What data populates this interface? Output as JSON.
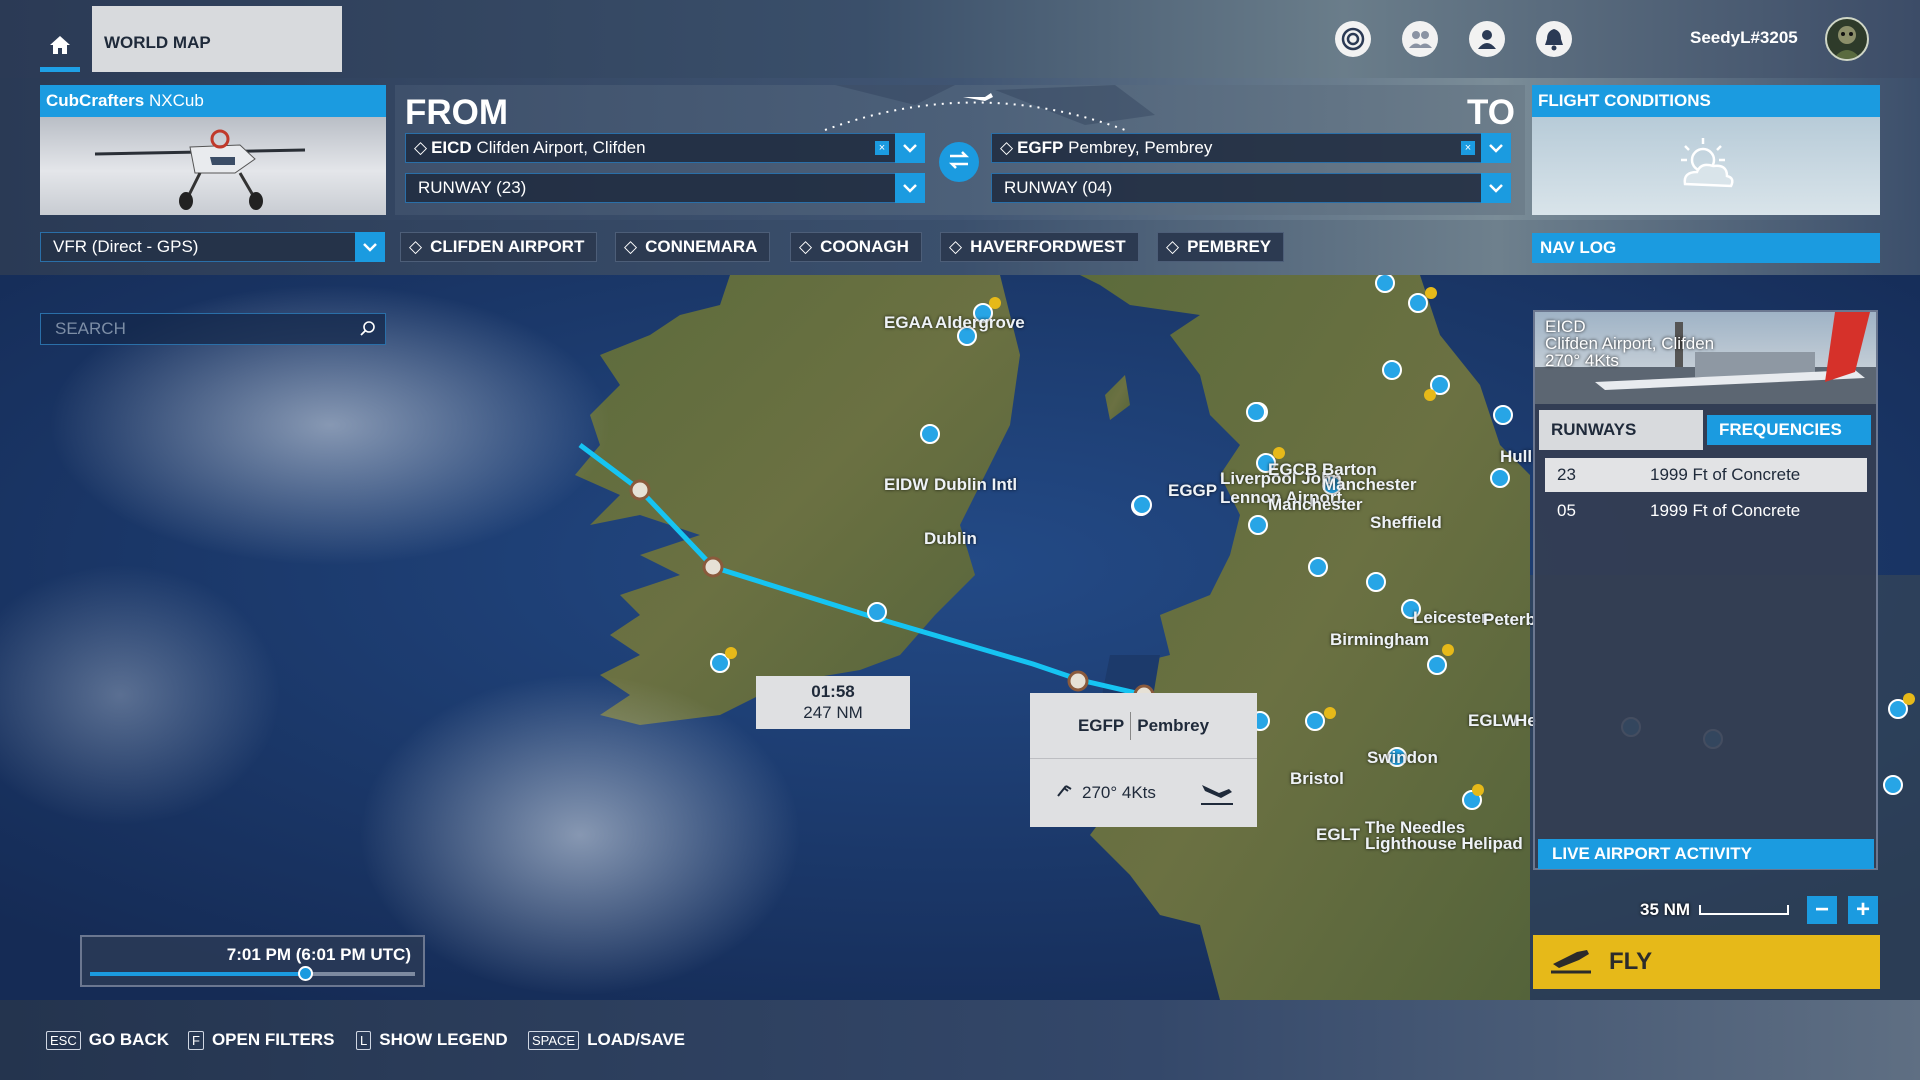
{
  "topbar": {
    "tab_label": "WORLD MAP",
    "username": "SeedyL#3205",
    "icons": [
      "home-icon",
      "activity-icon",
      "friends-icon",
      "profile-icon",
      "notifications-icon"
    ]
  },
  "aircraft": {
    "name_brand": "CubCrafters",
    "name_model": "NXCub"
  },
  "route": {
    "from_label": "FROM",
    "to_label": "TO",
    "from": {
      "code": "EICD",
      "name": "Clifden Airport, Clifden",
      "runway": "RUNWAY (23)"
    },
    "to": {
      "code": "EGFP",
      "name": "Pembrey, Pembrey",
      "runway": "RUNWAY (04)"
    }
  },
  "conditions": {
    "title": "FLIGHT CONDITIONS",
    "weather_icon": "partly-cloudy-icon"
  },
  "plan": {
    "type": "VFR (Direct - GPS)",
    "waypoints": [
      "CLIFDEN AIRPORT",
      "CONNEMARA",
      "COONAGH",
      "HAVERFORDWEST",
      "PEMBREY"
    ],
    "navlog_label": "NAV LOG"
  },
  "map": {
    "search_placeholder": "SEARCH",
    "labels": {
      "egaa_code": "EGAA",
      "egaa_name": "Aldergrove",
      "eidw_code": "EIDW",
      "eidw_name": "Dublin Intl",
      "dublin": "Dublin",
      "eggp_code": "EGGP",
      "eggp_name_1": "Liverpool John",
      "eggp_name_2": "Lennon Airport",
      "egcb_code": "EGCB",
      "egcb_name_1": "Barton",
      "egcb_name_2": "Manchester",
      "manchester": "Manchester",
      "sheffield": "Sheffield",
      "hull": "Hull",
      "leicester": "Leicester",
      "peterb": "Peterb",
      "birmingham": "Birmingham",
      "swindon": "Swindon",
      "bristol": "Bristol",
      "eglw_code": "EGLW",
      "eglw_name": "He",
      "eglt_code": "EGLT",
      "eglt_name_1": "The Needles",
      "eglt_name_2": "Lighthouse Helipad"
    },
    "leg": {
      "time": "01:58",
      "distance": "247 NM"
    },
    "dest_popup": {
      "code": "EGFP",
      "name": "Pembrey",
      "wind": "270° 4Kts"
    },
    "scale": "35 NM",
    "zoom_out": "−",
    "zoom_in": "+",
    "time": "7:01 PM (6:01 PM UTC)",
    "time_progress": 0.66
  },
  "side_panel": {
    "code": "EICD",
    "name": "Clifden Airport, Clifden",
    "wind": "270° 4Kts",
    "tab_runways": "RUNWAYS",
    "tab_frequencies": "FREQUENCIES",
    "runways": [
      {
        "id": "23",
        "desc": "1999 Ft of Concrete"
      },
      {
        "id": "05",
        "desc": "1999 Ft of Concrete"
      }
    ],
    "live_label": "LIVE AIRPORT ACTIVITY"
  },
  "fly_label": "FLY",
  "hints": [
    {
      "key": "ESC",
      "label": "GO BACK"
    },
    {
      "key": "F",
      "label": "OPEN FILTERS"
    },
    {
      "key": "L",
      "label": "SHOW LEGEND"
    },
    {
      "key": "SPACE",
      "label": "LOAD/SAVE"
    }
  ],
  "colors": {
    "accent": "#1b9be0",
    "fly": "#e6b919",
    "route": "#16c4f2",
    "water": "#1a3462",
    "land": "#55663a"
  }
}
